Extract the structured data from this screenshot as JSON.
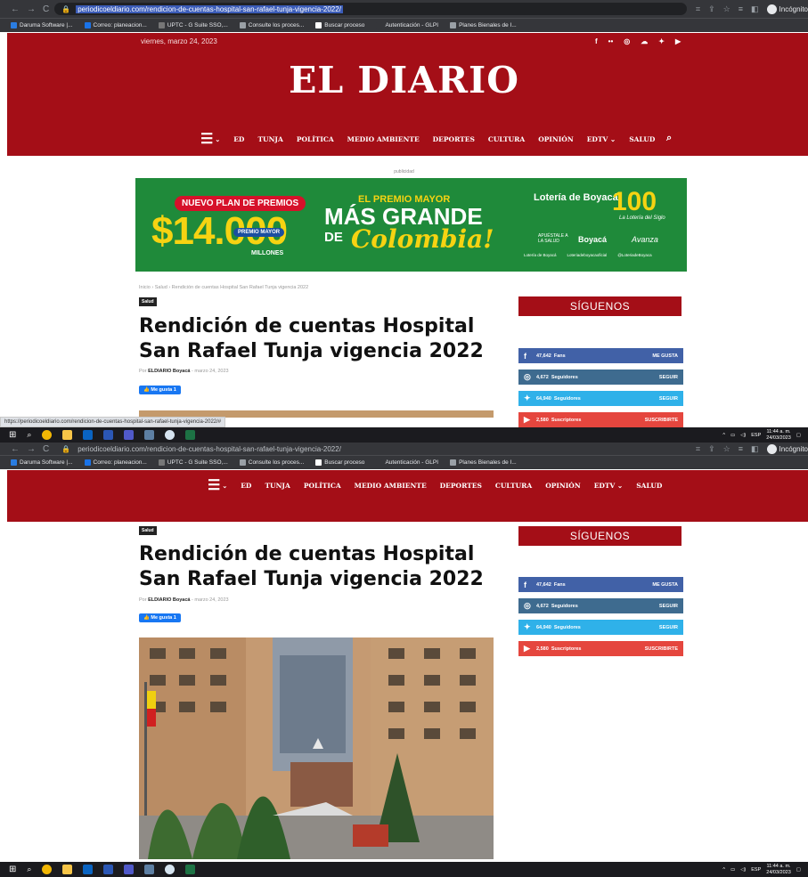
{
  "browser": {
    "url_1": "periodicoeldiario.com/rendicion-de-cuentas-hospital-san-rafael-tunja-vigencia-2022/",
    "url_2": "periodicoeldiario.com/rendicion-de-cuentas-hospital-san-rafael-tunja-vigencia-2022/",
    "incognito_label": "Incógnito",
    "bookmarks": [
      {
        "label": "Daruma Software |...",
        "color": "#2a7de1"
      },
      {
        "label": "Correo: planeacion...",
        "color": "#1a73e8"
      },
      {
        "label": "UPTC - G Suite SSO,...",
        "color": "#777777"
      },
      {
        "label": "Consulte los proces...",
        "color": "#9aa0a6"
      },
      {
        "label": "Buscar proceso",
        "color": "#ffffff"
      },
      {
        "label": "Autenticación - GLPI",
        "color": "#35363a"
      },
      {
        "label": "Planes Bienales de I...",
        "color": "#9aa0a6"
      }
    ],
    "status_url": "https://periodicoeldiario.com/rendicion-de-cuentas-hospital-san-rafael-tunja-vigencia-2022/#"
  },
  "site": {
    "date": "viernes, marzo 24, 2023",
    "logo": "EL DIARIO",
    "nav": [
      "ED",
      "TUNJA",
      "POLÍTICA",
      "MEDIO AMBIENTE",
      "DEPORTES",
      "CULTURA",
      "OPINIÓN",
      "EDTV ⌄",
      "SALUD"
    ],
    "accent": "#a40e17"
  },
  "ad": {
    "label": "publicidad",
    "pill": "NUEVO PLAN DE PREMIOS",
    "amount": "$14.000",
    "premio_mayor": "PREMIO MAYOR",
    "millones": "MILLONES",
    "headline_top": "EL PREMIO MAYOR",
    "headline_main": "MÁS GRANDE",
    "headline_de": "DE",
    "headline_colombia": "Colombia!",
    "brand": "Lotería de Boyacá",
    "hundred": "100",
    "siglo": "La Lotería del Siglo",
    "apuestale": "APUÉSTALE A LA SALUD",
    "boyaca": "Boyacá",
    "avanza": "Avanza",
    "socials": [
      "Lotería de Boyacá",
      "Loteriadeboyacaoficial",
      "@LoteriadeBoyaca"
    ]
  },
  "article": {
    "breadcrumb": "Inicio  ›  Salud  ›  Rendición de cuentas Hospital San Rafael Tunja vigencia 2022",
    "category": "Salud",
    "title": "Rendición de cuentas Hospital San Rafael Tunja vigencia 2022",
    "by": "Por",
    "author": "ELDIARIO Boyacá",
    "date": "marzo 24, 2023",
    "like": "Me gusta 1"
  },
  "sidebar": {
    "heading": "SÍGUENOS",
    "rows": [
      {
        "icon": "f",
        "count": "47,642",
        "label": "Fans",
        "action": "ME GUSTA"
      },
      {
        "icon": "◎",
        "count": "4,672",
        "label": "Seguidores",
        "action": "SEGUIR"
      },
      {
        "icon": "✦",
        "count": "64,940",
        "label": "Seguidores",
        "action": "SEGUIR"
      },
      {
        "icon": "▶",
        "count": "2,580",
        "label": "Suscriptores",
        "action": "SUSCRIBIRTE"
      }
    ]
  },
  "taskbar": {
    "lang": "ESP",
    "time": "11:44 a. m.",
    "date": "24/03/2023"
  }
}
